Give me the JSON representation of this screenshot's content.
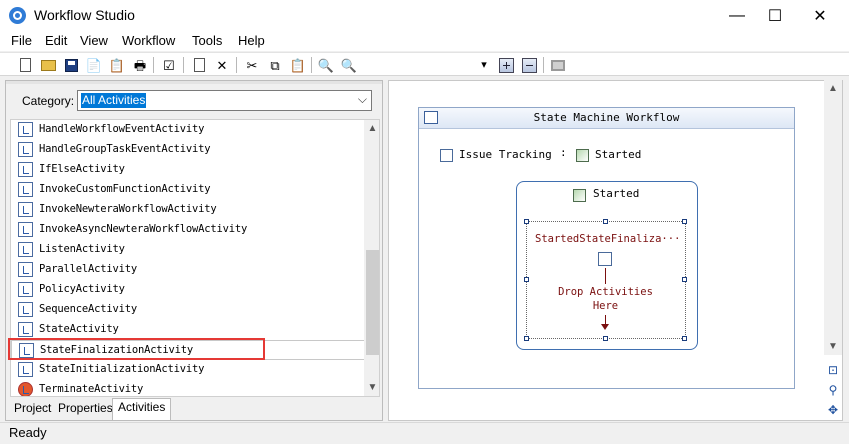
{
  "window": {
    "title": "Workflow Studio",
    "minimize": "—",
    "maximize": "☐",
    "close": "✕"
  },
  "menu": [
    "File",
    "Edit",
    "View",
    "Workflow",
    "Tools",
    "Help"
  ],
  "toolbar": {
    "icons": [
      "new-icon",
      "open-icon",
      "save-icon",
      "copy-page-icon",
      "paste-page-icon",
      "print-icon",
      "checklist-icon",
      "document-icon",
      "delete-icon",
      "cut-icon",
      "copy-icon",
      "paste-icon",
      "zoom-in-icon",
      "zoom-out-icon",
      "dropdown-arrow-icon",
      "expand-icon",
      "collapse-icon",
      "monitor-icon"
    ],
    "dropdown_arrow": "▾"
  },
  "left_panel": {
    "category_label": "Category:",
    "category_value": "All Activities",
    "chevron": "⌵",
    "activities": [
      "HandleWorkflowEventActivity",
      "HandleGroupTaskEventActivity",
      "IfElseActivity",
      "InvokeCustomFunctionActivity",
      "InvokeNewteraWorkflowActivity",
      "InvokeAsyncNewteraWorkflowActivity",
      "ListenActivity",
      "ParallelActivity",
      "PolicyActivity",
      "SequenceActivity",
      "StateActivity",
      "StateFinalizationActivity",
      "StateInitializationActivity",
      "TerminateActivity"
    ],
    "selected_activity": "StateFinalizationActivity",
    "scroll_up": "▲",
    "scroll_down": "▼"
  },
  "tabs": [
    "Project",
    "Properties",
    "Activities"
  ],
  "active_tab": "Activities",
  "designer": {
    "workflow_title": "State Machine Workflow",
    "field_name": "Issue Tracking",
    "field_sep": ":",
    "initial_state": "Started",
    "state_title": "Started",
    "finalization_label": "StartedStateFinaliza···",
    "drop_text_1": "Drop Activities",
    "drop_text_2": "Here",
    "nav_icons": [
      "navigate-icon",
      "search-icon",
      "pan-icon"
    ],
    "scroll_up": "▲",
    "scroll_down": "▼"
  },
  "status": "Ready"
}
